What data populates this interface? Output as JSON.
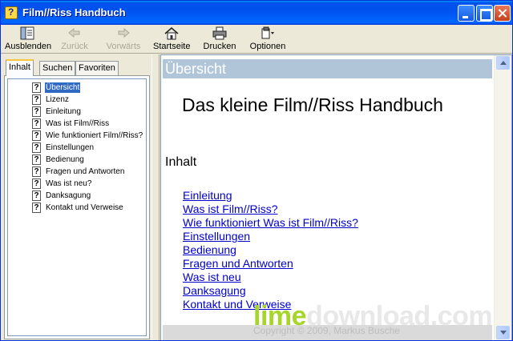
{
  "window": {
    "title": "Film//Riss Handbuch"
  },
  "toolbar": {
    "hide": "Ausblenden",
    "back": "Zurück",
    "forward": "Vorwärts",
    "home": "Startseite",
    "print": "Drucken",
    "options": "Optionen"
  },
  "nav": {
    "tabs": [
      "Inhalt",
      "Suchen",
      "Favoriten"
    ],
    "items": [
      "Übersicht",
      "Lizenz",
      "Einleitung",
      "Was ist Film//Riss",
      "Wie funktioniert Film//Riss?",
      "Einstellungen",
      "Bedienung",
      "Fragen und Antworten",
      "Was ist neu?",
      "Danksagung",
      "Kontakt und Verweise"
    ]
  },
  "content": {
    "header": "Übersicht",
    "title": "Das kleine Film//Riss Handbuch",
    "section": "Inhalt",
    "links": [
      "Einleitung",
      "Was ist Film//Riss?",
      "Wie funktioniert Was ist Film//Riss?",
      "Einstellungen",
      "Bedienung",
      "Fragen und Antworten",
      "Was ist neu",
      "Danksagung",
      "Kontakt und Verweise"
    ],
    "copyright": "Copyright © 2009, Markus Busche"
  },
  "watermark": {
    "lime": "lime",
    "rest": "download.com"
  },
  "colors": {
    "titlebar": "#0053EE",
    "link": "#0000CC",
    "header_bar": "#B0C6D8",
    "selection": "#316AC5"
  }
}
